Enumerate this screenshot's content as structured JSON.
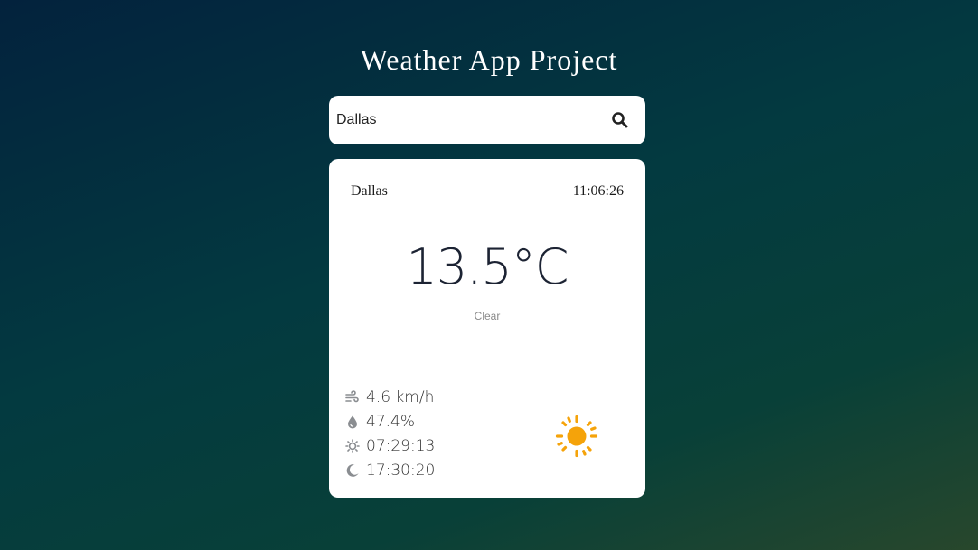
{
  "header": {
    "title": "Weather App Project"
  },
  "search": {
    "value": "Dallas",
    "placeholder": ""
  },
  "weather": {
    "city": "Dallas",
    "time": "11:06:26",
    "temperature": "13.5°C",
    "condition": "Clear",
    "wind": "4.6 km/h",
    "humidity": "47.4%",
    "sunrise": "07:29:13",
    "sunset": "17:30:20",
    "condition_icon": "sun-icon"
  },
  "colors": {
    "accent_sun": "#f5a30a",
    "detail_icon": "#8a8d91"
  }
}
